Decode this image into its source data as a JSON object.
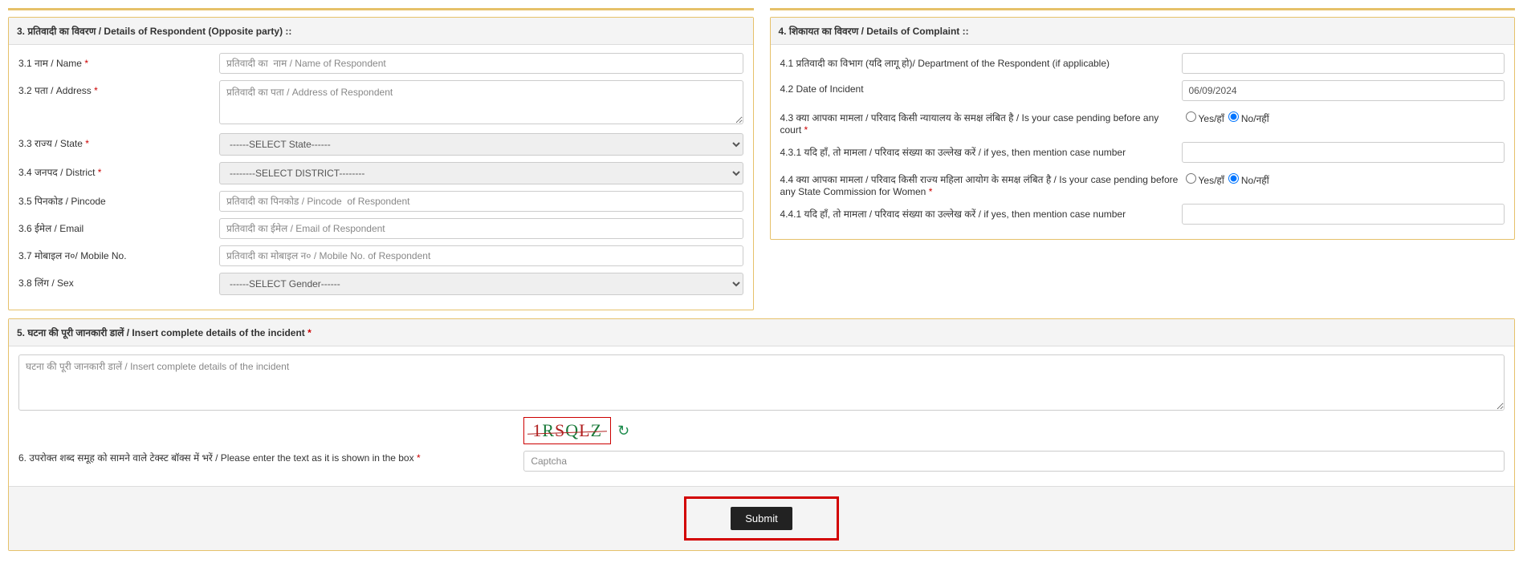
{
  "section3": {
    "heading": "3. प्रतिवादी का विवरण / Details of Respondent (Opposite party) ::",
    "name_label": "3.1 नाम / Name",
    "name_ph": "प्रतिवादी का  नाम / Name of Respondent",
    "address_label": "3.2 पता / Address",
    "address_ph": "प्रतिवादी का पता / Address of Respondent",
    "state_label": "3.3 राज्य / State",
    "state_opt": "------SELECT State------",
    "district_label": "3.4 जनपद / District",
    "district_opt": "--------SELECT DISTRICT--------",
    "pincode_label": "3.5 पिनकोड / Pincode",
    "pincode_ph": "प्रतिवादी का पिनकोड / Pincode  of Respondent",
    "email_label": "3.6 ईमेल / Email",
    "email_ph": "प्रतिवादी का ईमेल / Email of Respondent",
    "mobile_label": "3.7 मोबाइल न०/ Mobile No.",
    "mobile_ph": "प्रतिवादी का मोबाइल न० / Mobile No. of Respondent",
    "sex_label": "3.8 लिंग / Sex",
    "sex_opt": "------SELECT Gender------"
  },
  "section4": {
    "heading": "4. शिकायत का विवरण / Details of Complaint ::",
    "dept_label": "4.1 प्रतिवादी का विभाग (यदि लागू हो)/ Department of the Respondent (if applicable)",
    "date_label": "4.2 Date of Incident",
    "date_value": "06/09/2024",
    "court_label": "4.3 क्या आपका मामला / परिवाद किसी न्यायालय के समक्ष लंबित है / Is your case pending before any court",
    "court_case_label": "4.3.1 यदि हाँ, तो मामला / परिवाद संख्या का उल्लेख करें / if yes, then mention case number",
    "commission_label": "4.4 क्या आपका मामला / परिवाद किसी राज्य महिला आयोग के समक्ष लंबित है / Is your case pending before any State Commission for Women",
    "commission_case_label": "4.4.1 यदि हाँ, तो मामला / परिवाद संख्या का उल्लेख करें / if yes, then mention case number",
    "yes_label": "Yes/हाँ",
    "no_label": "No/नहीं"
  },
  "section5": {
    "heading": "5. घटना की पूरी जानकारी डालें / Insert complete details of the incident",
    "details_ph": "घटना की पूरी जानकारी डालें / Insert complete details of the incident",
    "captcha_label": "6. उपरोक्त शब्द समूह को सामने वाले टेक्स्ट बॉक्स में भरें / Please enter the text as it is shown in the box",
    "captcha_text": "1RSQLZ",
    "captcha_ph": "Captcha",
    "submit": "Submit"
  }
}
